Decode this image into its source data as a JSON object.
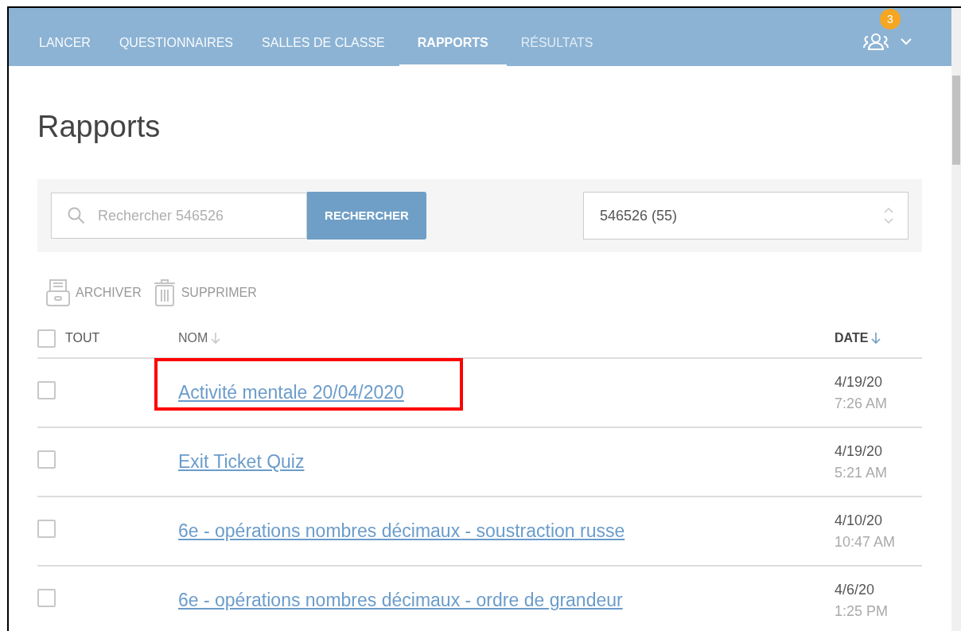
{
  "nav": {
    "tabs": [
      {
        "label": "LANCER",
        "selected": false,
        "disabled": false
      },
      {
        "label": "QUESTIONNAIRES",
        "selected": false,
        "disabled": false
      },
      {
        "label": "SALLES DE CLASSE",
        "selected": false,
        "disabled": false
      },
      {
        "label": "RAPPORTS",
        "selected": true,
        "disabled": false
      },
      {
        "label": "RÉSULTATS",
        "selected": false,
        "disabled": true
      }
    ],
    "badge": "3"
  },
  "title": "Rapports",
  "search": {
    "placeholder": "Rechercher 546526",
    "button": "RECHERCHER"
  },
  "room_select": {
    "value": "546526 (55)"
  },
  "actions": [
    "ARCHIVER",
    "SUPPRIMER"
  ],
  "table": {
    "select_all": {
      "label": "TOUT",
      "checked": false
    },
    "columns": [
      {
        "label": "NOM",
        "sorted": false
      },
      {
        "label": "DATE",
        "sorted": true
      }
    ],
    "rows": [
      {
        "name": "Activité mentale 20/04/2020",
        "date": "4/19/20",
        "time": "7:26 AM",
        "checked": false,
        "highlighted": true
      },
      {
        "name": "Exit Ticket Quiz",
        "date": "4/19/20",
        "time": "5:21 AM",
        "checked": false,
        "highlighted": false
      },
      {
        "name": "6e - opérations nombres décimaux - soustraction russe",
        "date": "4/10/20",
        "time": "10:47 AM",
        "checked": false,
        "highlighted": false
      },
      {
        "name": "6e - opérations nombres décimaux - ordre de grandeur",
        "date": "4/6/20",
        "time": "1:25 PM",
        "checked": false,
        "highlighted": false
      }
    ]
  }
}
